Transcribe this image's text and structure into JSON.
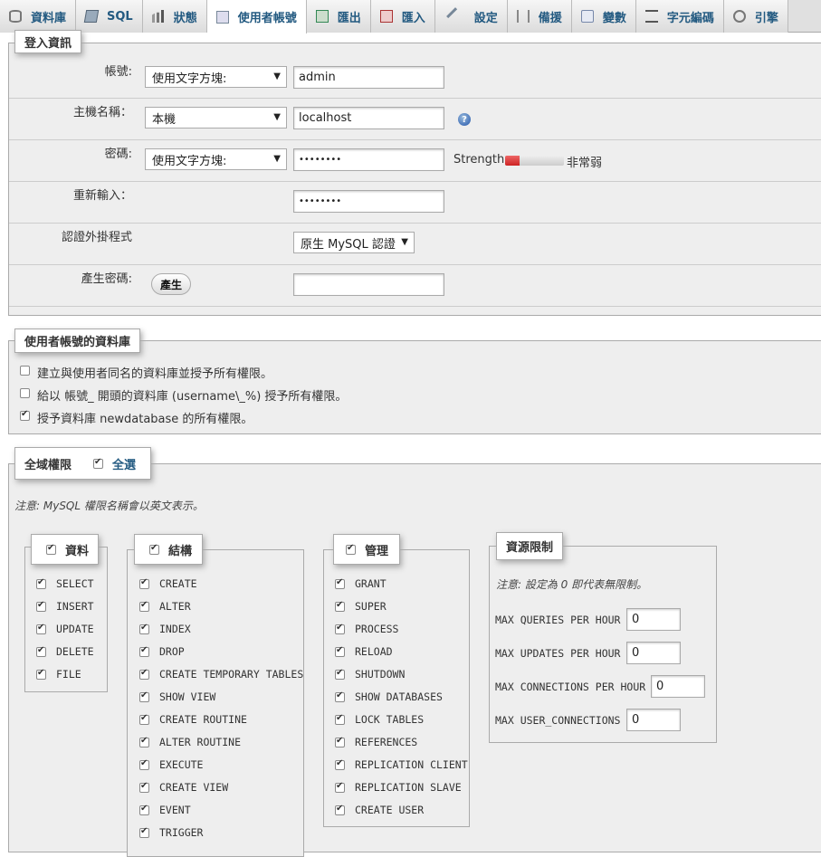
{
  "tabs": [
    {
      "label": "資料庫",
      "icon": "database-icon"
    },
    {
      "label": "SQL",
      "icon": "sql-icon"
    },
    {
      "label": "狀態",
      "icon": "status-chart-icon"
    },
    {
      "label": "使用者帳號",
      "icon": "user-accounts-icon",
      "active": true
    },
    {
      "label": "匯出",
      "icon": "export-icon"
    },
    {
      "label": "匯入",
      "icon": "import-icon"
    },
    {
      "label": "設定",
      "icon": "wrench-icon"
    },
    {
      "label": "備援",
      "icon": "replication-icon"
    },
    {
      "label": "變數",
      "icon": "variables-icon"
    },
    {
      "label": "字元編碼",
      "icon": "charset-icon"
    },
    {
      "label": "引擎",
      "icon": "engine-icon"
    }
  ],
  "login": {
    "legend": "登入資訊",
    "username_label": "帳號:",
    "username_type": "使用文字方塊:",
    "username_value": "admin",
    "host_label": "主機名稱：",
    "host_type": "本機",
    "host_value": "localhost",
    "password_label": "密碼:",
    "password_type": "使用文字方塊:",
    "password_value": "••••••••",
    "strength_label": "Strength:",
    "strength_text": "非常弱",
    "strength_level": 0.25,
    "retype_label": "重新輸入：",
    "retype_value": "••••••••",
    "auth_label": "認證外掛程式",
    "auth_value": "原生 MySQL 認證",
    "generate_label": "產生密碼:",
    "generate_button": "產生",
    "generated_value": ""
  },
  "database_section": {
    "legend": "使用者帳號的資料庫",
    "options": [
      {
        "label": "建立與使用者同名的資料庫並授予所有權限。",
        "checked": false
      },
      {
        "label": "給以 帳號_ 開頭的資料庫 (username\\_%) 授予所有權限。",
        "checked": false
      },
      {
        "label": "授予資料庫 newdatabase 的所有權限。",
        "checked": true
      }
    ]
  },
  "global_privileges": {
    "legend": "全域權限",
    "select_all": "全選",
    "note": "注意: MySQL 權限名稱會以英文表示。",
    "data": {
      "legend": "資料",
      "items": [
        "SELECT",
        "INSERT",
        "UPDATE",
        "DELETE",
        "FILE"
      ]
    },
    "structure": {
      "legend": "結構",
      "items": [
        "CREATE",
        "ALTER",
        "INDEX",
        "DROP",
        "CREATE TEMPORARY TABLES",
        "SHOW VIEW",
        "CREATE ROUTINE",
        "ALTER ROUTINE",
        "EXECUTE",
        "CREATE VIEW",
        "EVENT",
        "TRIGGER"
      ]
    },
    "admin": {
      "legend": "管理",
      "items": [
        "GRANT",
        "SUPER",
        "PROCESS",
        "RELOAD",
        "SHUTDOWN",
        "SHOW DATABASES",
        "LOCK TABLES",
        "REFERENCES",
        "REPLICATION CLIENT",
        "REPLICATION SLAVE",
        "CREATE USER"
      ]
    },
    "limits": {
      "legend": "資源限制",
      "note": "注意: 設定為 0 即代表無限制。",
      "items": [
        {
          "label": "MAX QUERIES PER HOUR",
          "value": "0"
        },
        {
          "label": "MAX UPDATES PER HOUR",
          "value": "0"
        },
        {
          "label": "MAX CONNECTIONS PER HOUR",
          "value": "0"
        },
        {
          "label": "MAX USER_CONNECTIONS",
          "value": "0"
        }
      ]
    }
  },
  "colors": {
    "link": "#235a81",
    "strength_bar": "#d9333a",
    "panel": "#eeeeee"
  }
}
